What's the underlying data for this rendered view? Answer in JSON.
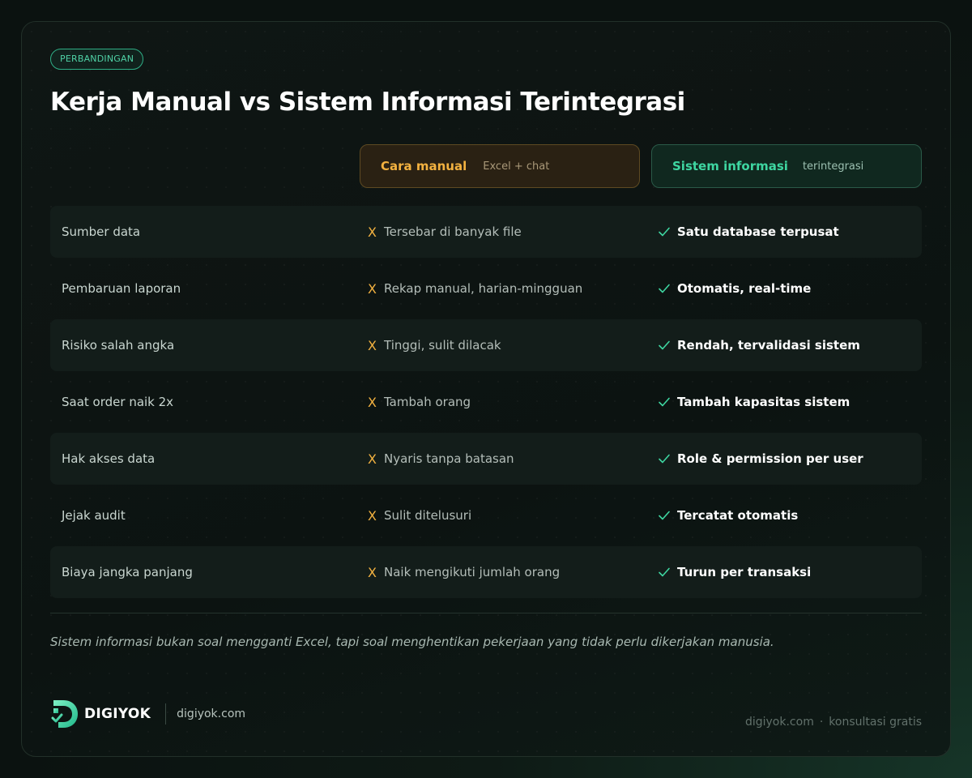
{
  "badge": "PERBANDINGAN",
  "title": "Kerja Manual vs Sistem Informasi Terintegrasi",
  "columns": {
    "manual": {
      "main": "Cara manual",
      "sub": "Excel + chat"
    },
    "system": {
      "main": "Sistem informasi",
      "sub": "terintegrasi"
    }
  },
  "icons": {
    "manual_marker": "x-icon",
    "system_marker": "check-icon"
  },
  "colors": {
    "accent_green": "#3ed6a1",
    "accent_orange": "#f3b240",
    "background": "#0c1311"
  },
  "rows": [
    {
      "label": "Sumber data",
      "manual": "Tersebar di banyak file",
      "system": "Satu database terpusat"
    },
    {
      "label": "Pembaruan laporan",
      "manual": "Rekap manual, harian-mingguan",
      "system": "Otomatis, real-time"
    },
    {
      "label": "Risiko salah angka",
      "manual": "Tinggi, sulit dilacak",
      "system": "Rendah, tervalidasi sistem"
    },
    {
      "label": "Saat order naik 2x",
      "manual": "Tambah orang",
      "system": "Tambah kapasitas sistem"
    },
    {
      "label": "Hak akses data",
      "manual": "Nyaris tanpa batasan",
      "system": "Role & permission per user"
    },
    {
      "label": "Jejak audit",
      "manual": "Sulit ditelusuri",
      "system": "Tercatat otomatis"
    },
    {
      "label": "Biaya jangka panjang",
      "manual": "Naik mengikuti jumlah orang",
      "system": "Turun per transaksi"
    }
  ],
  "quote": "Sistem informasi bukan soal mengganti Excel, tapi soal menghentikan pekerjaan yang tidak perlu dikerjakan manusia.",
  "brand": {
    "name": "DIGIYOK",
    "url": "digiyok.com"
  },
  "footer": {
    "site": "digiyok.com",
    "separator": "·",
    "cta": "konsultasi gratis"
  }
}
